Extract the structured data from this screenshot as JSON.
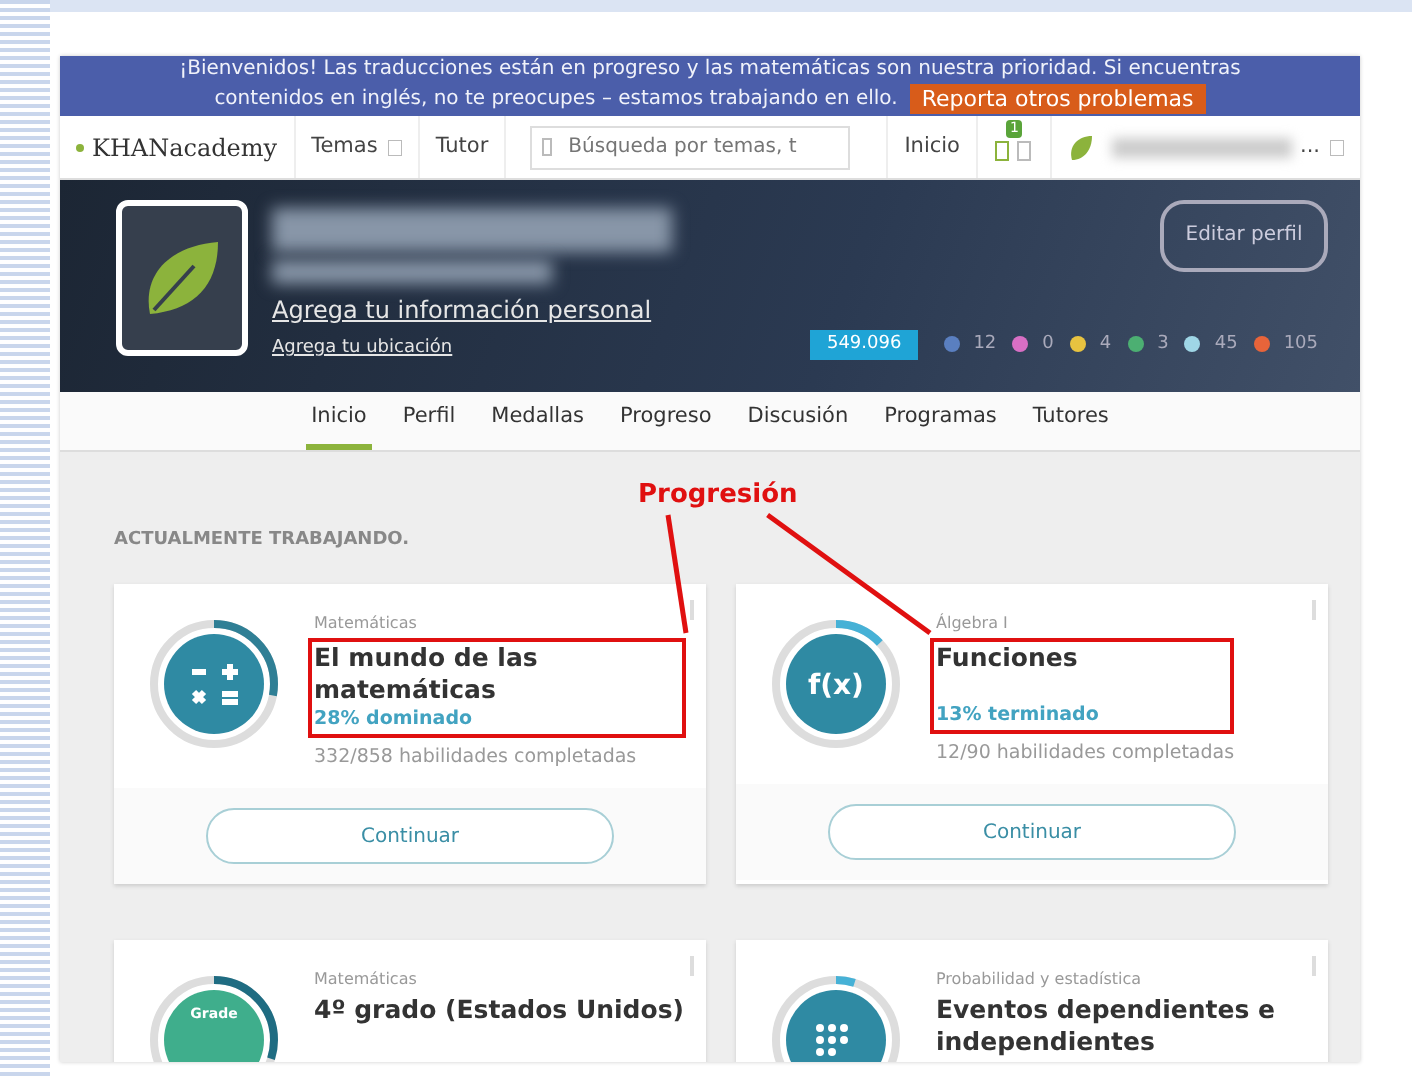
{
  "banner": {
    "lines": [
      "¡Bienvenidos! Las traducciones están en progreso y las matemáticas son nuestra prioridad. Si encuentras",
      "contenidos en inglés, no te preocupes – estamos trabajando en ello."
    ],
    "button": "Reporta otros problemas"
  },
  "navbar": {
    "logo": "KHANacademy",
    "items": [
      {
        "label": "Temas",
        "dropdown": true
      },
      {
        "label": "Tutor",
        "dropdown": false
      }
    ],
    "search": {
      "placeholder": "Búsqueda por temas, t"
    },
    "home": "Inicio",
    "notifications": "1",
    "user_ellipsis": "..."
  },
  "profile": {
    "add_info": "Agrega tu información personal",
    "add_location": "Agrega tu ubicación",
    "edit_button": "Editar perfil",
    "points": "549.096",
    "badges": [
      {
        "count": "12",
        "color": "#5a7fc0"
      },
      {
        "count": "0",
        "color": "#d86fc4"
      },
      {
        "count": "4",
        "color": "#e8c340"
      },
      {
        "count": "3",
        "color": "#4caf72"
      },
      {
        "count": "45",
        "color": "#9fd6e6"
      },
      {
        "count": "105",
        "color": "#e8643a"
      }
    ]
  },
  "tabs": [
    {
      "label": "Inicio",
      "selected": true
    },
    {
      "label": "Perfil",
      "selected": false
    },
    {
      "label": "Medallas",
      "selected": false
    },
    {
      "label": "Progreso",
      "selected": false
    },
    {
      "label": "Discusión",
      "selected": false
    },
    {
      "label": "Programas",
      "selected": false
    },
    {
      "label": "Tutores",
      "selected": false
    }
  ],
  "section_title": "ACTUALMENTE TRABAJANDO.",
  "annotation": {
    "label": "Progresión",
    "color": "#e01010"
  },
  "courses": [
    {
      "kind": "ops",
      "subject": "Matemáticas",
      "title": "El mundo de las matemáticas",
      "progress": "28% dominado",
      "skills": "332/858 habilidades completadas",
      "level": 0.28,
      "highlighted": true,
      "button": "Continuar"
    },
    {
      "kind": "fx",
      "icon_text": "f(x)",
      "subject": "Álgebra I",
      "title": "Funciones",
      "progress": "13% terminado",
      "skills": "12/90 habilidades completadas",
      "level": 0.13,
      "highlighted": true,
      "button": "Continuar"
    },
    {
      "kind": "grade",
      "icon_text": "Grade",
      "subject": "Matemáticas",
      "title": "4º grado (Estados Unidos)",
      "level": 0.3,
      "highlighted": false
    },
    {
      "kind": "dots",
      "subject": "Probabilidad y estadística",
      "title": "Eventos dependientes e independientes",
      "level": 0.05,
      "highlighted": false
    }
  ]
}
